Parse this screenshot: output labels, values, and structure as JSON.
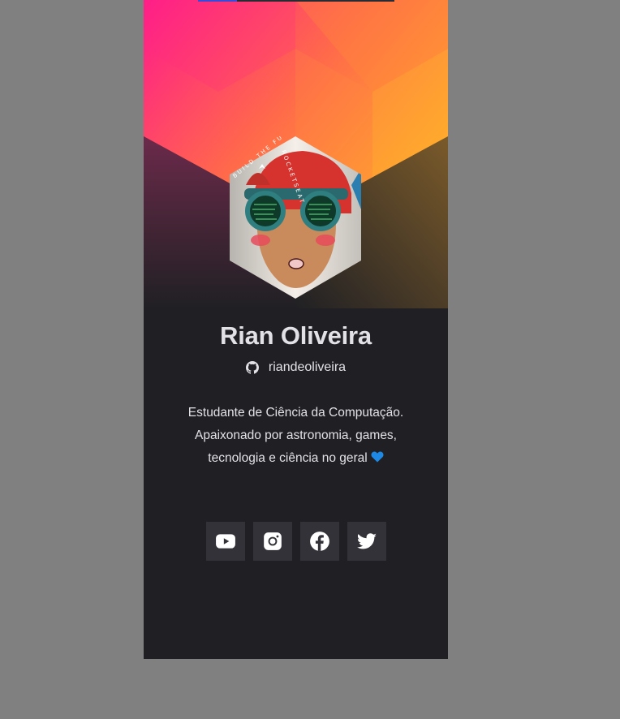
{
  "profile": {
    "name": "Rian Oliveira",
    "username": "riandeoliveira",
    "bio_line1": "Estudante de Ciência da Computação.",
    "bio_line2": "Apaixonado por astronomia, games,",
    "bio_line3": "tecnologia e ciência no geral"
  },
  "avatar": {
    "badge_text_left": "BUILD THE FUTURE",
    "badge_text_right": "ROCKETSEAT"
  },
  "socials": [
    {
      "icon": "youtube-icon"
    },
    {
      "icon": "instagram-icon"
    },
    {
      "icon": "facebook-icon"
    },
    {
      "icon": "twitter-icon"
    }
  ],
  "colors": {
    "page_bg": "#808080",
    "card_bg": "#202024",
    "text": "#e1e1e6",
    "social_bg": "#323238",
    "gradient_start": "#ff1a8c",
    "gradient_end": "#ffa62b",
    "heart": "#1e88e5"
  }
}
